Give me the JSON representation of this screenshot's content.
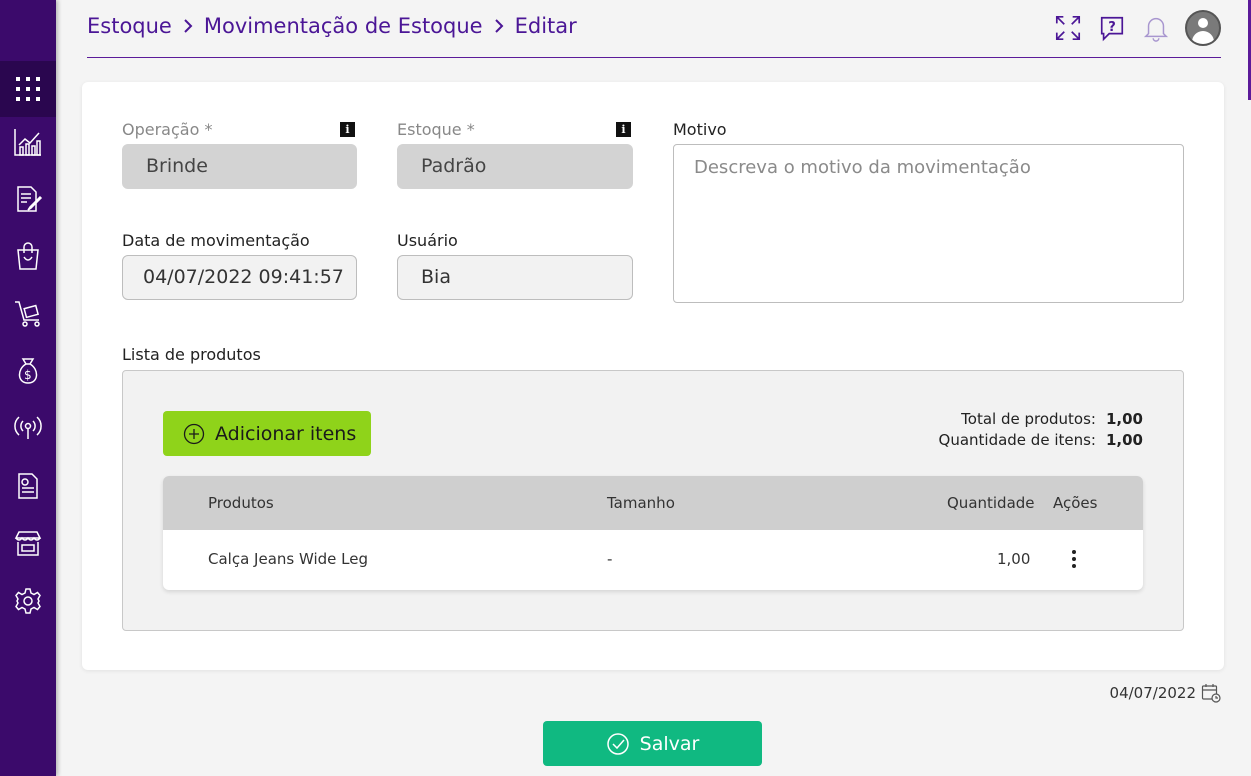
{
  "breadcrumb": [
    "Estoque",
    "Movimentação de Estoque",
    "Editar"
  ],
  "header_icons": [
    "expand-icon",
    "help-icon",
    "bell-icon",
    "user-avatar"
  ],
  "sidebar": {
    "items": [
      "grid-icon",
      "chart-icon",
      "document-edit-icon",
      "shopping-bag-icon",
      "cart-icon",
      "money-bag-icon",
      "broadcast-icon",
      "receipt-icon",
      "store-icon",
      "gear-icon"
    ]
  },
  "form": {
    "operacao": {
      "label": "Operação *",
      "value": "Brinde"
    },
    "estoque": {
      "label": "Estoque *",
      "value": "Padrão"
    },
    "motivo": {
      "label": "Motivo",
      "placeholder": "Descreva o motivo da movimentação"
    },
    "data": {
      "label": "Data de movimentação",
      "value": "04/07/2022 09:41:57"
    },
    "usuario": {
      "label": "Usuário",
      "value": "Bia"
    }
  },
  "products": {
    "section_label": "Lista de produtos",
    "add_button": "Adicionar itens",
    "total_produtos_label": "Total de produtos:",
    "total_produtos_value": "1,00",
    "qtd_itens_label": "Quantidade de itens:",
    "qtd_itens_value": "1,00",
    "columns": [
      "Produtos",
      "Tamanho",
      "Quantidade",
      "Ações"
    ],
    "rows": [
      {
        "produto": "Calça Jeans Wide Leg",
        "tamanho": "-",
        "quantidade": "1,00"
      }
    ]
  },
  "footer": {
    "date": "04/07/2022",
    "save_button": "Salvar"
  },
  "colors": {
    "primary": "#4b1696",
    "sidebar": "#3b0a6b",
    "add": "#8fd31a",
    "save": "#10b981"
  }
}
